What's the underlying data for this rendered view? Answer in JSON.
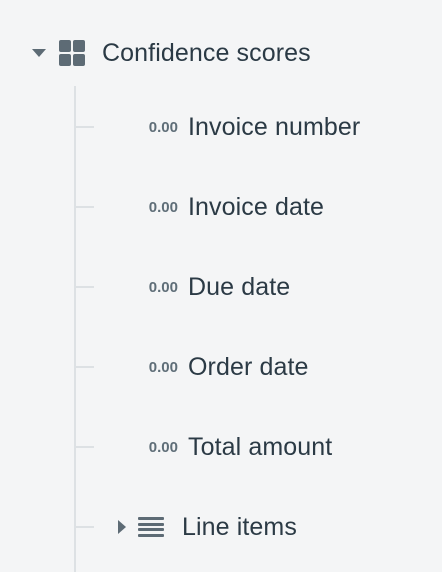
{
  "group": {
    "label": "Confidence scores",
    "icon": "grid-icon",
    "expanded": true
  },
  "fields": [
    {
      "score": "0.00",
      "label": "Invoice number"
    },
    {
      "score": "0.00",
      "label": "Invoice date"
    },
    {
      "score": "0.00",
      "label": "Due date"
    },
    {
      "score": "0.00",
      "label": "Order date"
    },
    {
      "score": "0.00",
      "label": "Total amount"
    }
  ],
  "sub_group": {
    "label": "Line items",
    "icon": "list-icon",
    "expanded": false
  },
  "colors": {
    "background": "#f4f5f6",
    "text": "#2b3a45",
    "muted": "#5f6e78",
    "icon": "#5d6b75",
    "tree_line": "#dde1e4"
  }
}
